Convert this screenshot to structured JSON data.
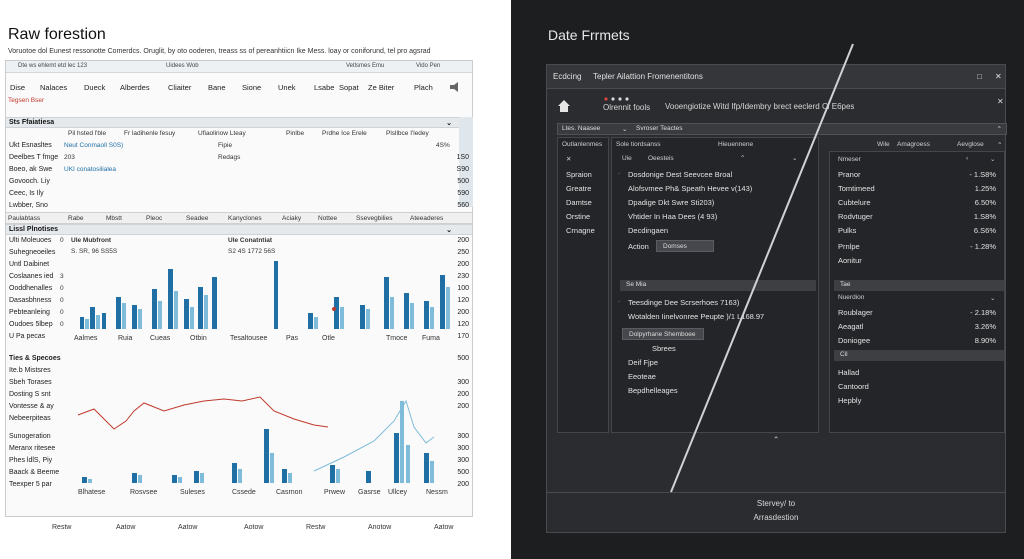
{
  "left": {
    "title": "Raw forestion",
    "subtitle": "Voruotoe dol Eunest ressonotte Comerdcs. Oruglit, by oto ooderen, treass ss of pereanhtiicn Ike Mess. loay or coniforund, tel pro agsrad",
    "toolbar_items": [
      "Dte ws ehlemt etd lec 123",
      "Uidees Wob",
      "Vetlsmes Emu",
      "Vido Pen"
    ],
    "menu_items": [
      "Dise",
      "Nalaces",
      "Dueck",
      "Alberdes",
      "Cliaiter",
      "Bane",
      "Sione",
      "Unek",
      "Lsabe",
      "Sopat",
      "Ze Biter",
      "Plach"
    ],
    "red_label": "Tegsen Bser",
    "section1": {
      "title": "Sts Ffaiatiesa",
      "cols": [
        "Pil hsted l'ble",
        "Fr ladihenle fesuy",
        "Ufiaolinow Lteay",
        "Pinlbe",
        "Prdhe Ice Erele",
        "Plsllbce I'ledey"
      ],
      "rows": [
        "Ukt Esnasltes",
        "Deelbes T fmge",
        "Boeo, ak Swe",
        "Govooch. Liy",
        "Ceec, Is Ily",
        "Lwbber, Sno"
      ],
      "cell1": "Neut Conmaoll S0S)",
      "cell2": "UKI conatosilialea",
      "cell3": "Fipie",
      "cell4": "Redags",
      "cell5": "203",
      "pct": "4S%",
      "right_nums": [
        "1S0",
        "S90",
        "500",
        "590",
        "560"
      ]
    },
    "tabs1": [
      "Paulabtass",
      "Rabe",
      "Mbstt",
      "Pleoc",
      "Seadee",
      "Kanyclones",
      "Aciaky",
      "Nottee",
      "Ssevegbilies",
      "Ateeaderes"
    ],
    "section2": {
      "title": "Lissl Plnotises",
      "rows": [
        "Ulti Moleuoes",
        "Suhegneoeiles",
        "Untl Daibinet",
        "Coslaanes ied",
        "Ooddhenalles",
        "Dasasbhness",
        "Pebteanleing",
        "Oudoes 5lbep",
        "U Pa pecas"
      ],
      "axis_left": [
        "0",
        "3",
        "0",
        "0",
        "0",
        "0",
        "5"
      ],
      "legend1": "Ule Mubfront",
      "legend1_sub": "S. SR, 96 SS5S",
      "legend2": "Ule Conatntiat",
      "legend2_sub": "S2 4S 1772 56S",
      "right_nums": [
        "200",
        "250",
        "200",
        "230",
        "100",
        "120",
        "200",
        "120",
        "170"
      ],
      "x_labels": [
        "Aalmes",
        "Ruia",
        "Cueas",
        "Otbin",
        "Tesaltousee",
        "Pas",
        "Otle",
        "Tmoce",
        "Fuma"
      ]
    },
    "section3": {
      "title": "Ties & Specoes",
      "rows": [
        "Ite.b Mistsres",
        "Sbeh Torases",
        "Dosting S snt",
        "Vontesse & ay",
        "Nebeerpiteas",
        "Sunogeration",
        "Meranx ritesee",
        "Phes ldlS, Piy",
        "Baack & Beeme",
        "Teexper 5 par"
      ],
      "right_nums": [
        "500",
        "300",
        "200",
        "200",
        "300",
        "300",
        "300",
        "500",
        "200"
      ],
      "x_labels": [
        "Blhatese",
        "Rosvsee",
        "Suleses",
        "Cssede",
        "Casrnon",
        "Prwew",
        "Gasrse",
        "Ullcey",
        "Nessm"
      ]
    },
    "bottom_labels": [
      "Restw",
      "Aatow",
      "Aatow",
      "Aotow",
      "Restw",
      "Anotow",
      "Aatow"
    ]
  },
  "right": {
    "title": "Date Frrmets",
    "window_title_1": "Ecdcing",
    "window_title_2": "Tepler Ailattion Fromenentitons",
    "toolbar_label": "Olrennit fools",
    "toolbar_text": "Vooengiotize Witd Ifp/Idembry brect eeclerd Cl E6pes",
    "path_bar_1": "Ltes. Naasee",
    "path_bar_2": "Svroser Teactes",
    "left_header": "Outlanlenmes",
    "left_items": [
      "Spraion",
      "Greatre",
      "Damtse",
      "Orstine",
      "Crnagne"
    ],
    "mid_header_1": "Sole tiordsanss",
    "mid_header_2": "Hieuennene",
    "mid_cols": [
      "Uie",
      "Oeesteis"
    ],
    "mid_items": [
      "Dosdonige Dest Seevcee Broal",
      "Alofsvmee Ph& Speath Hevee v(143)",
      "Dpadige Dkt Swre Sti203)",
      "Vhtider In Haa Dees (4 93)",
      "Decdingaen"
    ],
    "action_label": "Action",
    "action_btn": "Domses",
    "sec2_head": "Se Mia",
    "sec2_items": [
      "Teesdinge Dee Scrserhoes 7163)",
      "Wotalden Iinelvonree Peupte )/1 L168.97"
    ],
    "sec2_btn": "Dolpyrhane Shemboee",
    "sec3_items": [
      "Sbrees",
      "Deif Fjpe",
      "Eeoteae",
      "Bepdhelleages"
    ],
    "right_header_1": "Wile",
    "right_header_2": "Amagroess",
    "right_header_3": "Aevglose",
    "right_col_head": "Nmeser",
    "right_items": [
      {
        "name": "Pranor",
        "value": "- 1.S8%"
      },
      {
        "name": "Tomtimeed",
        "value": "1.25%"
      },
      {
        "name": "Cubtelure",
        "value": "6.50%"
      },
      {
        "name": "Rodvtuger",
        "value": "1.S8%"
      },
      {
        "name": "Pulks",
        "value": "6.S6%"
      },
      {
        "name": "Prnlpe",
        "value": "- 1.28%"
      },
      {
        "name": "Aonitur",
        "value": ""
      }
    ],
    "right_sec2_head": "Tae",
    "right_sec2_sub": "Nuerdion",
    "right_items_2": [
      {
        "name": "Roublager",
        "value": "- 2.18%"
      },
      {
        "name": "Aeagatl",
        "value": "3.26%"
      },
      {
        "name": "Doniogee",
        "value": "8.90%"
      }
    ],
    "right_cel": "Cil",
    "right_items_3": [
      "Hallad",
      "Cantoord",
      "Hepbly"
    ],
    "footer_line1": "Stervey/ to",
    "footer_line2": "Arrasdestion"
  }
}
